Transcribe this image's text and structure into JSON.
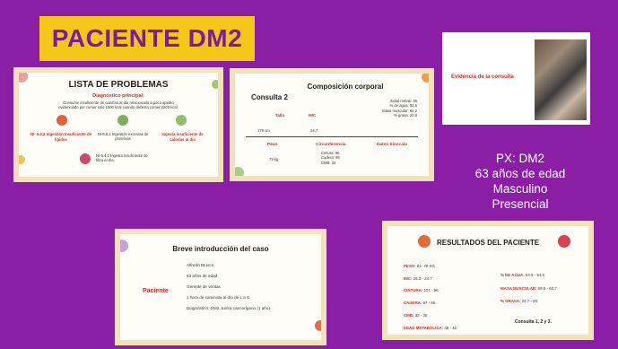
{
  "tag": "PACIENTE DM2",
  "card1": {
    "title": "LISTA DE PROBLEMAS",
    "sub": "Diagnóstico principal:",
    "desc": "Consume insuficiente de calorías al día relacionado a poco apetito evidenciado por comer solo 1500 kcal cuando debería comer 2200 kcal.",
    "items": [
      "NI- 5.4.2 Ingestión Insuficiente de lípidos",
      "NI-5.8.1 Ingestión excesiva de proteínas",
      "Ingesta insuficiente de calorías al día",
      "NI-5.4.2 Ingesta insuficiente de fibra al día."
    ]
  },
  "card2": {
    "title": "Composición corporal",
    "consulta": "Consulta 2",
    "talla_label": "Talla",
    "talla_value": "179 cm",
    "imc_label": "IMC",
    "imc_value": "24.7",
    "peso_label": "Peso",
    "peso_value": "79 kg",
    "circ_label": "Circunferencia",
    "circ_values": [
      "Cintura: 98",
      "Cadera: 96",
      "CMB: 32"
    ],
    "bio_label": "Datos bioscala",
    "bio_values": [
      "Edad metab: 46",
      "% de agua: 53.5",
      "Masa muscular: 60.2",
      "% grasa: 20.8"
    ]
  },
  "card3": {
    "title": "Evidencia de la consulta"
  },
  "right_text": [
    "PX: DM2",
    "63 años de edad",
    "Masculino",
    "Presencial"
  ],
  "card4": {
    "title": "Breve introducción del caso",
    "side": "Paciente",
    "lines": [
      "Alfredo Brusco",
      "63 años de edad",
      "Gerente de ventas",
      "1 hora de caminata al día de L a S.",
      "Diagnóstico: DM2, tumor cancerígeno (1 año)."
    ]
  },
  "card5": {
    "title": "RESULTADOS DEL PACIENTE",
    "left": [
      {
        "k": "PESO:",
        "v": "81- 79 KG"
      },
      {
        "k": "IMC:",
        "v": "25.3 - 24.7"
      },
      {
        "k": "CINTURA:",
        "v": "101 - 96"
      },
      {
        "k": "CADERA:",
        "v": "97 - 96"
      },
      {
        "k": "CMB:",
        "v": "32 - 30"
      },
      {
        "k": "EDAD METABÓLICA:",
        "v": "48 - 46"
      }
    ],
    "right": [
      {
        "k": "% DE AGUA:",
        "v": "54.9 - 54.6"
      },
      {
        "k": "MASA MUSCULAR:",
        "v": "59.5 - 60.7"
      },
      {
        "k": "% GRASA:",
        "v": "22.7 - 20."
      }
    ],
    "note": "Consulta 1, 2 y 3."
  }
}
